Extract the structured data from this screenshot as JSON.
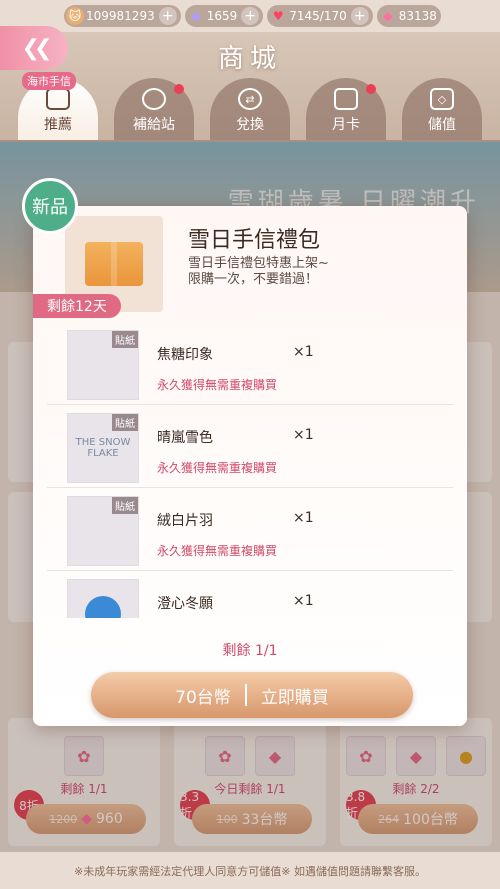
{
  "resources": {
    "id": "109981293",
    "gems": "1659",
    "hearts": "7145/170",
    "diamonds": "83138"
  },
  "header": {
    "title": "商城",
    "tab_badge": "海市手信"
  },
  "tabs": [
    {
      "label": "推薦"
    },
    {
      "label": "補給站"
    },
    {
      "label": "兌換"
    },
    {
      "label": "月卡"
    },
    {
      "label": "儲值"
    }
  ],
  "banner": {
    "text": "雪瑚歲暑 日曜潮升"
  },
  "modal": {
    "new_label": "新品",
    "title": "雪日手信禮包",
    "desc": "雪日手信禮包特惠上架~\n限購一次，不要錯過！",
    "days_left": "剩餘12天",
    "items": [
      {
        "tag": "貼紙",
        "name": "焦糖印象",
        "qty": "×1",
        "note": "永久獲得無需重複購買",
        "img_text": ""
      },
      {
        "tag": "貼紙",
        "name": "晴嵐雪色",
        "qty": "×1",
        "note": "永久獲得無需重複購買",
        "img_text": "THE SNOW FLAKE"
      },
      {
        "tag": "貼紙",
        "name": "絨白片羽",
        "qty": "×1",
        "note": "永久獲得無需重複購買",
        "img_text": ""
      },
      {
        "tag": "",
        "name": "澄心冬願",
        "qty": "×1",
        "note": "",
        "img_text": ""
      }
    ],
    "remaining": "剩餘 1/1",
    "price": "70台幣",
    "buy_label": "立即購買"
  },
  "bottom_cards": [
    {
      "discount": "8折",
      "remaining": "剩餘 1/1",
      "old_price": "1200",
      "price": "960"
    },
    {
      "discount": "3.3折",
      "remaining": "今日剩餘 1/1",
      "old_price": "100",
      "price": "33台幣"
    },
    {
      "discount": "3.8折",
      "remaining": "剩餘 2/2",
      "old_price": "264",
      "price": "100台幣"
    }
  ],
  "footer": "※未成年玩家需經法定代理人同意方可儲值※ 如遇儲值問題請聯繫客服。"
}
